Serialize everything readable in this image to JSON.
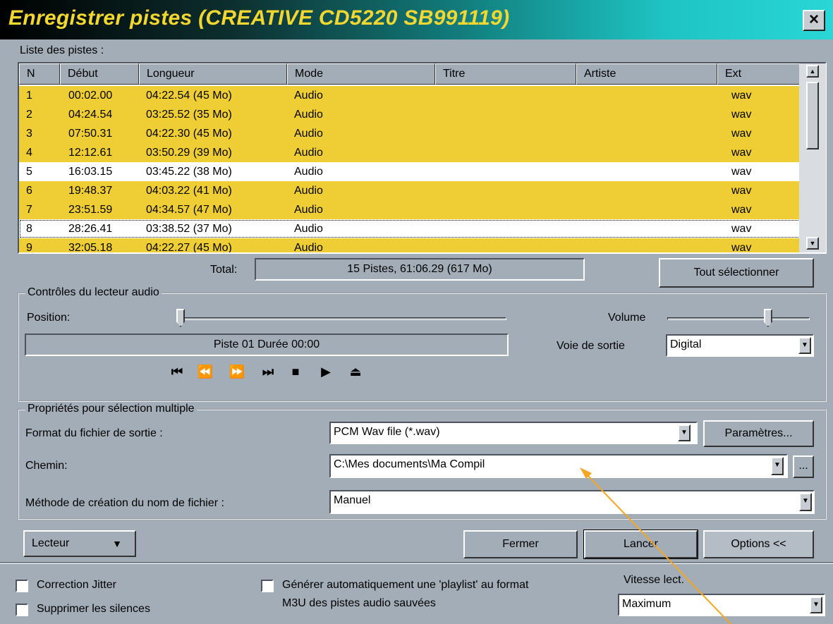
{
  "window": {
    "title": "Enregistrer pistes (CREATIVE CD5220  SB991119)",
    "close_label": "×"
  },
  "tracklist": {
    "label": "Liste des pistes :",
    "columns": [
      "N",
      "Début",
      "Longueur",
      "Mode",
      "Titre",
      "Artiste",
      "Ext"
    ],
    "rows": [
      {
        "n": "1",
        "debut": "00:02.00",
        "longueur": "04:22.54 (45 Mo)",
        "mode": "Audio",
        "titre": "",
        "artiste": "",
        "ext": "wav",
        "selected": true
      },
      {
        "n": "2",
        "debut": "04:24.54",
        "longueur": "03:25.52 (35 Mo)",
        "mode": "Audio",
        "titre": "",
        "artiste": "",
        "ext": "wav",
        "selected": true
      },
      {
        "n": "3",
        "debut": "07:50.31",
        "longueur": "04:22.30 (45 Mo)",
        "mode": "Audio",
        "titre": "",
        "artiste": "",
        "ext": "wav",
        "selected": true
      },
      {
        "n": "4",
        "debut": "12:12.61",
        "longueur": "03:50.29 (39 Mo)",
        "mode": "Audio",
        "titre": "",
        "artiste": "",
        "ext": "wav",
        "selected": true
      },
      {
        "n": "5",
        "debut": "16:03.15",
        "longueur": "03:45.22 (38 Mo)",
        "mode": "Audio",
        "titre": "",
        "artiste": "",
        "ext": "wav",
        "selected": false
      },
      {
        "n": "6",
        "debut": "19:48.37",
        "longueur": "04:03.22 (41 Mo)",
        "mode": "Audio",
        "titre": "",
        "artiste": "",
        "ext": "wav",
        "selected": true
      },
      {
        "n": "7",
        "debut": "23:51.59",
        "longueur": "04:34.57 (47 Mo)",
        "mode": "Audio",
        "titre": "",
        "artiste": "",
        "ext": "wav",
        "selected": true
      },
      {
        "n": "8",
        "debut": "28:26.41",
        "longueur": "03:38.52 (37 Mo)",
        "mode": "Audio",
        "titre": "",
        "artiste": "",
        "ext": "wav",
        "selected": false,
        "focused": true
      },
      {
        "n": "9",
        "debut": "32:05.18",
        "longueur": "04:22.27 (45 Mo)",
        "mode": "Audio",
        "titre": "",
        "artiste": "",
        "ext": "wav",
        "selected": true
      }
    ],
    "total_label": "Total:",
    "total_value": "15 Pistes, 61:06.29 (617 Mo)",
    "select_all": "Tout sélectionner"
  },
  "player": {
    "legend": "Contrôles du lecteur audio",
    "position_label": "Position:",
    "position_fraction": 0.0,
    "status": "Piste 01 Durée 00:00",
    "volume_label": "Volume",
    "volume_fraction": 0.72,
    "output_label": "Voie de sortie",
    "output_value": "Digital",
    "transport": [
      "⏮",
      "⏪",
      "⏩",
      "⏭",
      "■",
      "▶",
      "⏏"
    ]
  },
  "props": {
    "legend": "Propriétés pour sélection multiple",
    "format_label": "Format du fichier de sortie :",
    "format_value": "PCM Wav file (*.wav)",
    "params_button": "Paramètres...",
    "path_label": "Chemin:",
    "path_value": "C:\\Mes documents\\Ma Compil",
    "browse_button": "...",
    "naming_label": "Méthode de création du nom de fichier :",
    "naming_value": "Manuel"
  },
  "actions": {
    "lecteur": "Lecteur",
    "fermer": "Fermer",
    "lancer": "Lancer",
    "options": "Options <<"
  },
  "options": {
    "jitter": "Correction Jitter",
    "silences": "Supprimer les silences",
    "playlist_line1": "Générer automatiquement une 'playlist' au format",
    "playlist_line2": "M3U des pistes audio sauvées",
    "speed_label": "Vitesse lect.",
    "speed_value": "Maximum"
  },
  "colors": {
    "dialog_bg": "#a2adb8",
    "title_text": "#f2d731",
    "selection": "#efcd34",
    "annotation_arrow": "#f5a623"
  }
}
